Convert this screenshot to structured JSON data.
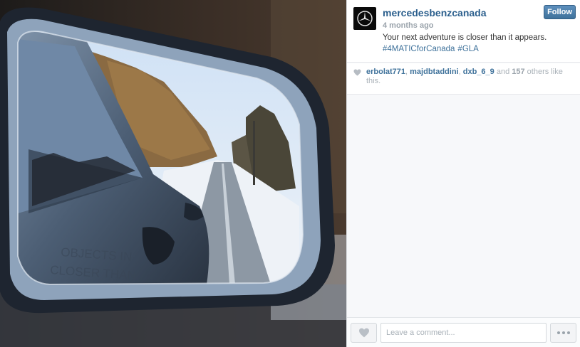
{
  "post": {
    "username": "mercedesbenzcanada",
    "timestamp": "4 months ago",
    "caption": "Your next adventure is closer than it appears.",
    "hashtags": [
      "#4MATICforCanada",
      "#GLA"
    ],
    "follow_label": "Follow",
    "image_icon": "car-side-mirror-photo"
  },
  "likes": {
    "users": [
      "erbolat771",
      "majdbtaddini",
      "dxb_6_9"
    ],
    "connector": "and",
    "others_count": "157",
    "suffix": "others like this."
  },
  "comment": {
    "placeholder": "Leave a comment..."
  },
  "icons": {
    "avatar": "mercedes-star-icon",
    "like": "heart-icon",
    "more": "more-dots-icon"
  },
  "colors": {
    "link": "#3f729b",
    "username": "#2b5f8d",
    "follow_button": "#4a7eae",
    "muted": "#a9b1b8"
  }
}
